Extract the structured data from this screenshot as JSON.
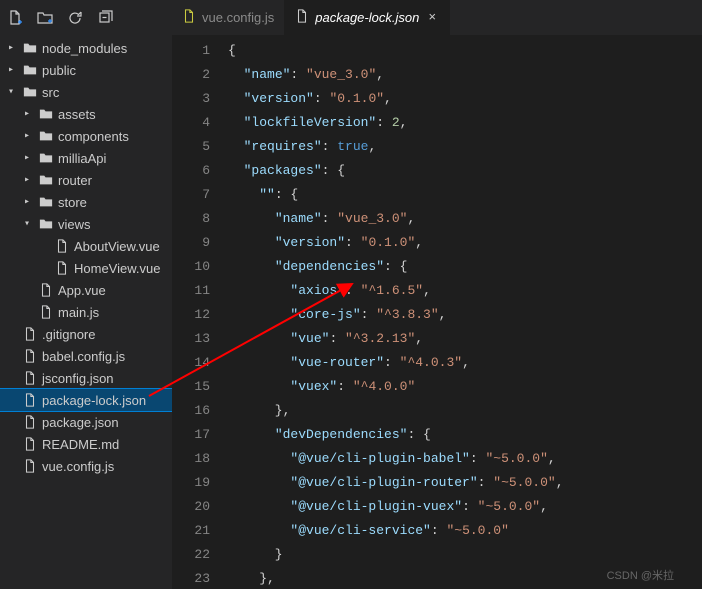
{
  "tabs": [
    {
      "label": "vue.config.js",
      "active": false
    },
    {
      "label": "package-lock.json",
      "active": true
    }
  ],
  "sidebar": [
    {
      "depth": 1,
      "twisty": "closed",
      "kind": "folder",
      "label": "node_modules"
    },
    {
      "depth": 1,
      "twisty": "closed",
      "kind": "folder",
      "label": "public"
    },
    {
      "depth": 1,
      "twisty": "open",
      "kind": "folder",
      "label": "src"
    },
    {
      "depth": 2,
      "twisty": "closed",
      "kind": "folder",
      "label": "assets"
    },
    {
      "depth": 2,
      "twisty": "closed",
      "kind": "folder",
      "label": "components"
    },
    {
      "depth": 2,
      "twisty": "closed",
      "kind": "folder",
      "label": "milliaApi"
    },
    {
      "depth": 2,
      "twisty": "closed",
      "kind": "folder",
      "label": "router"
    },
    {
      "depth": 2,
      "twisty": "closed",
      "kind": "folder",
      "label": "store"
    },
    {
      "depth": 2,
      "twisty": "open",
      "kind": "folder",
      "label": "views"
    },
    {
      "depth": 3,
      "twisty": "none",
      "kind": "file",
      "label": "AboutView.vue"
    },
    {
      "depth": 3,
      "twisty": "none",
      "kind": "file",
      "label": "HomeView.vue"
    },
    {
      "depth": 2,
      "twisty": "none",
      "kind": "file",
      "label": "App.vue"
    },
    {
      "depth": 2,
      "twisty": "none",
      "kind": "file",
      "label": "main.js"
    },
    {
      "depth": 1,
      "twisty": "none",
      "kind": "file",
      "label": ".gitignore"
    },
    {
      "depth": 1,
      "twisty": "none",
      "kind": "file",
      "label": "babel.config.js"
    },
    {
      "depth": 1,
      "twisty": "none",
      "kind": "file",
      "label": "jsconfig.json"
    },
    {
      "depth": 1,
      "twisty": "none",
      "kind": "file",
      "label": "package-lock.json",
      "selected": true
    },
    {
      "depth": 1,
      "twisty": "none",
      "kind": "file",
      "label": "package.json"
    },
    {
      "depth": 1,
      "twisty": "none",
      "kind": "file",
      "label": "README.md"
    },
    {
      "depth": 1,
      "twisty": "none",
      "kind": "file",
      "label": "vue.config.js"
    }
  ],
  "code": {
    "lines": [
      [
        {
          "t": "{",
          "c": "p"
        }
      ],
      [
        {
          "t": "  ",
          "c": "p"
        },
        {
          "t": "\"name\"",
          "c": "k"
        },
        {
          "t": ": ",
          "c": "p"
        },
        {
          "t": "\"vue_3.0\"",
          "c": "s"
        },
        {
          "t": ",",
          "c": "p"
        }
      ],
      [
        {
          "t": "  ",
          "c": "p"
        },
        {
          "t": "\"version\"",
          "c": "k"
        },
        {
          "t": ": ",
          "c": "p"
        },
        {
          "t": "\"0.1.0\"",
          "c": "s"
        },
        {
          "t": ",",
          "c": "p"
        }
      ],
      [
        {
          "t": "  ",
          "c": "p"
        },
        {
          "t": "\"lockfileVersion\"",
          "c": "k"
        },
        {
          "t": ": ",
          "c": "p"
        },
        {
          "t": "2",
          "c": "n"
        },
        {
          "t": ",",
          "c": "p"
        }
      ],
      [
        {
          "t": "  ",
          "c": "p"
        },
        {
          "t": "\"requires\"",
          "c": "k"
        },
        {
          "t": ": ",
          "c": "p"
        },
        {
          "t": "true",
          "c": "b"
        },
        {
          "t": ",",
          "c": "p"
        }
      ],
      [
        {
          "t": "  ",
          "c": "p"
        },
        {
          "t": "\"packages\"",
          "c": "k"
        },
        {
          "t": ": {",
          "c": "p"
        }
      ],
      [
        {
          "t": "    ",
          "c": "p"
        },
        {
          "t": "\"\"",
          "c": "k"
        },
        {
          "t": ": {",
          "c": "p"
        }
      ],
      [
        {
          "t": "      ",
          "c": "p"
        },
        {
          "t": "\"name\"",
          "c": "k"
        },
        {
          "t": ": ",
          "c": "p"
        },
        {
          "t": "\"vue_3.0\"",
          "c": "s"
        },
        {
          "t": ",",
          "c": "p"
        }
      ],
      [
        {
          "t": "      ",
          "c": "p"
        },
        {
          "t": "\"version\"",
          "c": "k"
        },
        {
          "t": ": ",
          "c": "p"
        },
        {
          "t": "\"0.1.0\"",
          "c": "s"
        },
        {
          "t": ",",
          "c": "p"
        }
      ],
      [
        {
          "t": "      ",
          "c": "p"
        },
        {
          "t": "\"dependencies\"",
          "c": "k"
        },
        {
          "t": ": {",
          "c": "p"
        }
      ],
      [
        {
          "t": "        ",
          "c": "p"
        },
        {
          "t": "\"axios\"",
          "c": "k"
        },
        {
          "t": ": ",
          "c": "p"
        },
        {
          "t": "\"^1.6.5\"",
          "c": "s"
        },
        {
          "t": ",",
          "c": "p"
        }
      ],
      [
        {
          "t": "        ",
          "c": "p"
        },
        {
          "t": "\"core-js\"",
          "c": "k"
        },
        {
          "t": ": ",
          "c": "p"
        },
        {
          "t": "\"^3.8.3\"",
          "c": "s"
        },
        {
          "t": ",",
          "c": "p"
        }
      ],
      [
        {
          "t": "        ",
          "c": "p"
        },
        {
          "t": "\"vue\"",
          "c": "k"
        },
        {
          "t": ": ",
          "c": "p"
        },
        {
          "t": "\"^3.2.13\"",
          "c": "s"
        },
        {
          "t": ",",
          "c": "p"
        }
      ],
      [
        {
          "t": "        ",
          "c": "p"
        },
        {
          "t": "\"vue-router\"",
          "c": "k"
        },
        {
          "t": ": ",
          "c": "p"
        },
        {
          "t": "\"^4.0.3\"",
          "c": "s"
        },
        {
          "t": ",",
          "c": "p"
        }
      ],
      [
        {
          "t": "        ",
          "c": "p"
        },
        {
          "t": "\"vuex\"",
          "c": "k"
        },
        {
          "t": ": ",
          "c": "p"
        },
        {
          "t": "\"^4.0.0\"",
          "c": "s"
        }
      ],
      [
        {
          "t": "      },",
          "c": "p"
        }
      ],
      [
        {
          "t": "      ",
          "c": "p"
        },
        {
          "t": "\"devDependencies\"",
          "c": "k"
        },
        {
          "t": ": {",
          "c": "p"
        }
      ],
      [
        {
          "t": "        ",
          "c": "p"
        },
        {
          "t": "\"@vue/cli-plugin-babel\"",
          "c": "k"
        },
        {
          "t": ": ",
          "c": "p"
        },
        {
          "t": "\"~5.0.0\"",
          "c": "s"
        },
        {
          "t": ",",
          "c": "p"
        }
      ],
      [
        {
          "t": "        ",
          "c": "p"
        },
        {
          "t": "\"@vue/cli-plugin-router\"",
          "c": "k"
        },
        {
          "t": ": ",
          "c": "p"
        },
        {
          "t": "\"~5.0.0\"",
          "c": "s"
        },
        {
          "t": ",",
          "c": "p"
        }
      ],
      [
        {
          "t": "        ",
          "c": "p"
        },
        {
          "t": "\"@vue/cli-plugin-vuex\"",
          "c": "k"
        },
        {
          "t": ": ",
          "c": "p"
        },
        {
          "t": "\"~5.0.0\"",
          "c": "s"
        },
        {
          "t": ",",
          "c": "p"
        }
      ],
      [
        {
          "t": "        ",
          "c": "p"
        },
        {
          "t": "\"@vue/cli-service\"",
          "c": "k"
        },
        {
          "t": ": ",
          "c": "p"
        },
        {
          "t": "\"~5.0.0\"",
          "c": "s"
        }
      ],
      [
        {
          "t": "      }",
          "c": "p"
        }
      ],
      [
        {
          "t": "    },",
          "c": "p"
        }
      ]
    ],
    "startLine": 1
  },
  "watermark": "CSDN @米拉"
}
